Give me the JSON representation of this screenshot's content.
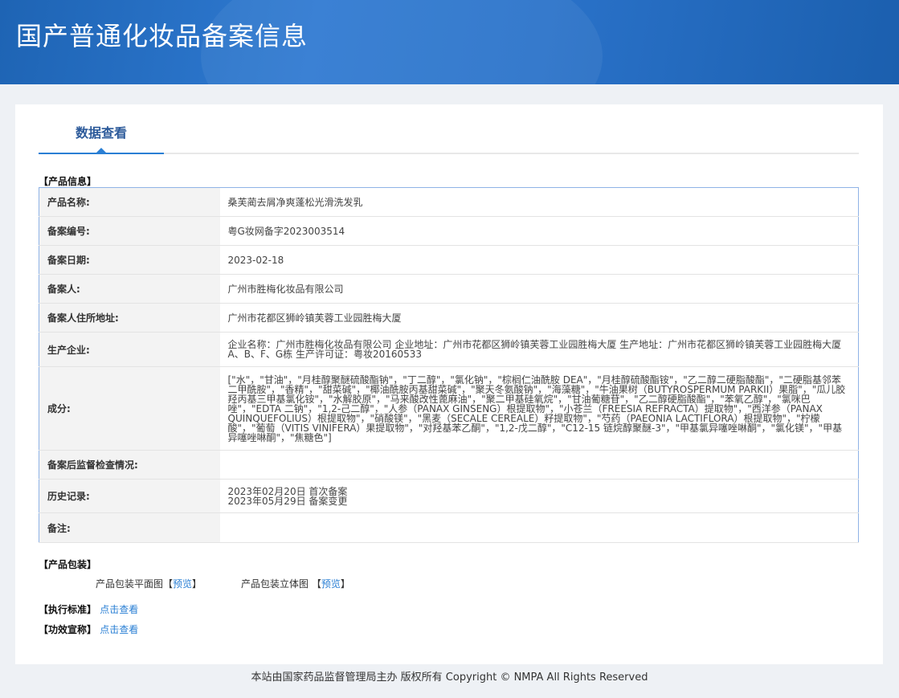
{
  "header": {
    "title": "国产普通化妆品备案信息"
  },
  "tab": {
    "label": "数据查看"
  },
  "sections": {
    "product_info": "【产品信息】",
    "packaging": "【产品包装】",
    "standard": "【执行标准】",
    "efficacy": "【功效宣称】"
  },
  "rows": [
    {
      "label": "产品名称:",
      "value": "桑芙蔺去屑净爽蓬松光滑洗发乳"
    },
    {
      "label": "备案编号:",
      "value": "粤G妆网备字2023003514"
    },
    {
      "label": "备案日期:",
      "value": "2023-02-18"
    },
    {
      "label": "备案人:",
      "value": "广州市胜梅化妆品有限公司"
    },
    {
      "label": "备案人住所地址:",
      "value": "广州市花都区狮岭镇芙蓉工业园胜梅大厦"
    },
    {
      "label": "生产企业:",
      "value": "企业名称：广州市胜梅化妆品有限公司 企业地址：广州市花都区狮岭镇芙蓉工业园胜梅大厦 生产地址：广州市花都区狮岭镇芙蓉工业园胜梅大厦A、B、F、G栋 生产许可证：粤妆20160533"
    },
    {
      "label": "成分:",
      "value": "[\"水\"，\"甘油\"，\"月桂醇聚醚硫酸酯钠\"，\"丁二醇\"，\"氯化钠\"，\"棕榈仁油酰胺 DEA\"，\"月桂醇硫酸酯铵\"，\"乙二醇二硬脂酸酯\"，\"二硬脂基邻苯二甲酰胺\"，\"香精\"，\"甜菜碱\"，\"椰油酰胺丙基甜菜碱\"，\"聚天冬氨酸钠\"，\"海藻糖\"，\"牛油果树（BUTYROSPERMUM PARKII）果脂\"，\"瓜儿胶羟丙基三甲基氯化铵\"，\"水解胶原\"，\"马来酸改性蓖麻油\"，\"聚二甲基硅氧烷\"，\"甘油葡糖苷\"，\"乙二醇硬脂酸酯\"，\"苯氧乙醇\"，\"氯咪巴唑\"，\"EDTA 二钠\"，\"1,2-己二醇\"，\"人参（PANAX GINSENG）根提取物\"，\"小苍兰（FREESIA REFRACTA）提取物\"，\"西洋参（PANAX QUINQUEFOLIUS）根提取物\"，\"硝酸镁\"，\"黑麦（SECALE CEREALE）籽提取物\"，\"芍药（PAEONIA LACTIFLORA）根提取物\"，\"柠檬酸\"，\"葡萄（VITIS VINIFERA）果提取物\"，\"对羟基苯乙酮\"，\"1,2-戊二醇\"，\"C12-15 链烷醇聚醚-3\"，\"甲基氯异噻唑啉酮\"，\"氯化镁\"，\"甲基异噻唑啉酮\"，\"焦糖色\"]"
    },
    {
      "label": "备案后监督检查情况:",
      "value": ""
    },
    {
      "label": "历史记录:",
      "value": "2023年02月20日 首次备案\n2023年05月29日 备案变更"
    },
    {
      "label": "备注:",
      "value": ""
    }
  ],
  "packaging": {
    "flat_label": "产品包装平面图",
    "3d_label": "产品包装立体图",
    "open": "【",
    "close": "】",
    "preview": "预览"
  },
  "links": {
    "view": "点击查看"
  },
  "footer": {
    "text": "本站由国家药品监督管理局主办 版权所有 Copyright © NMPA All Rights Reserved"
  }
}
